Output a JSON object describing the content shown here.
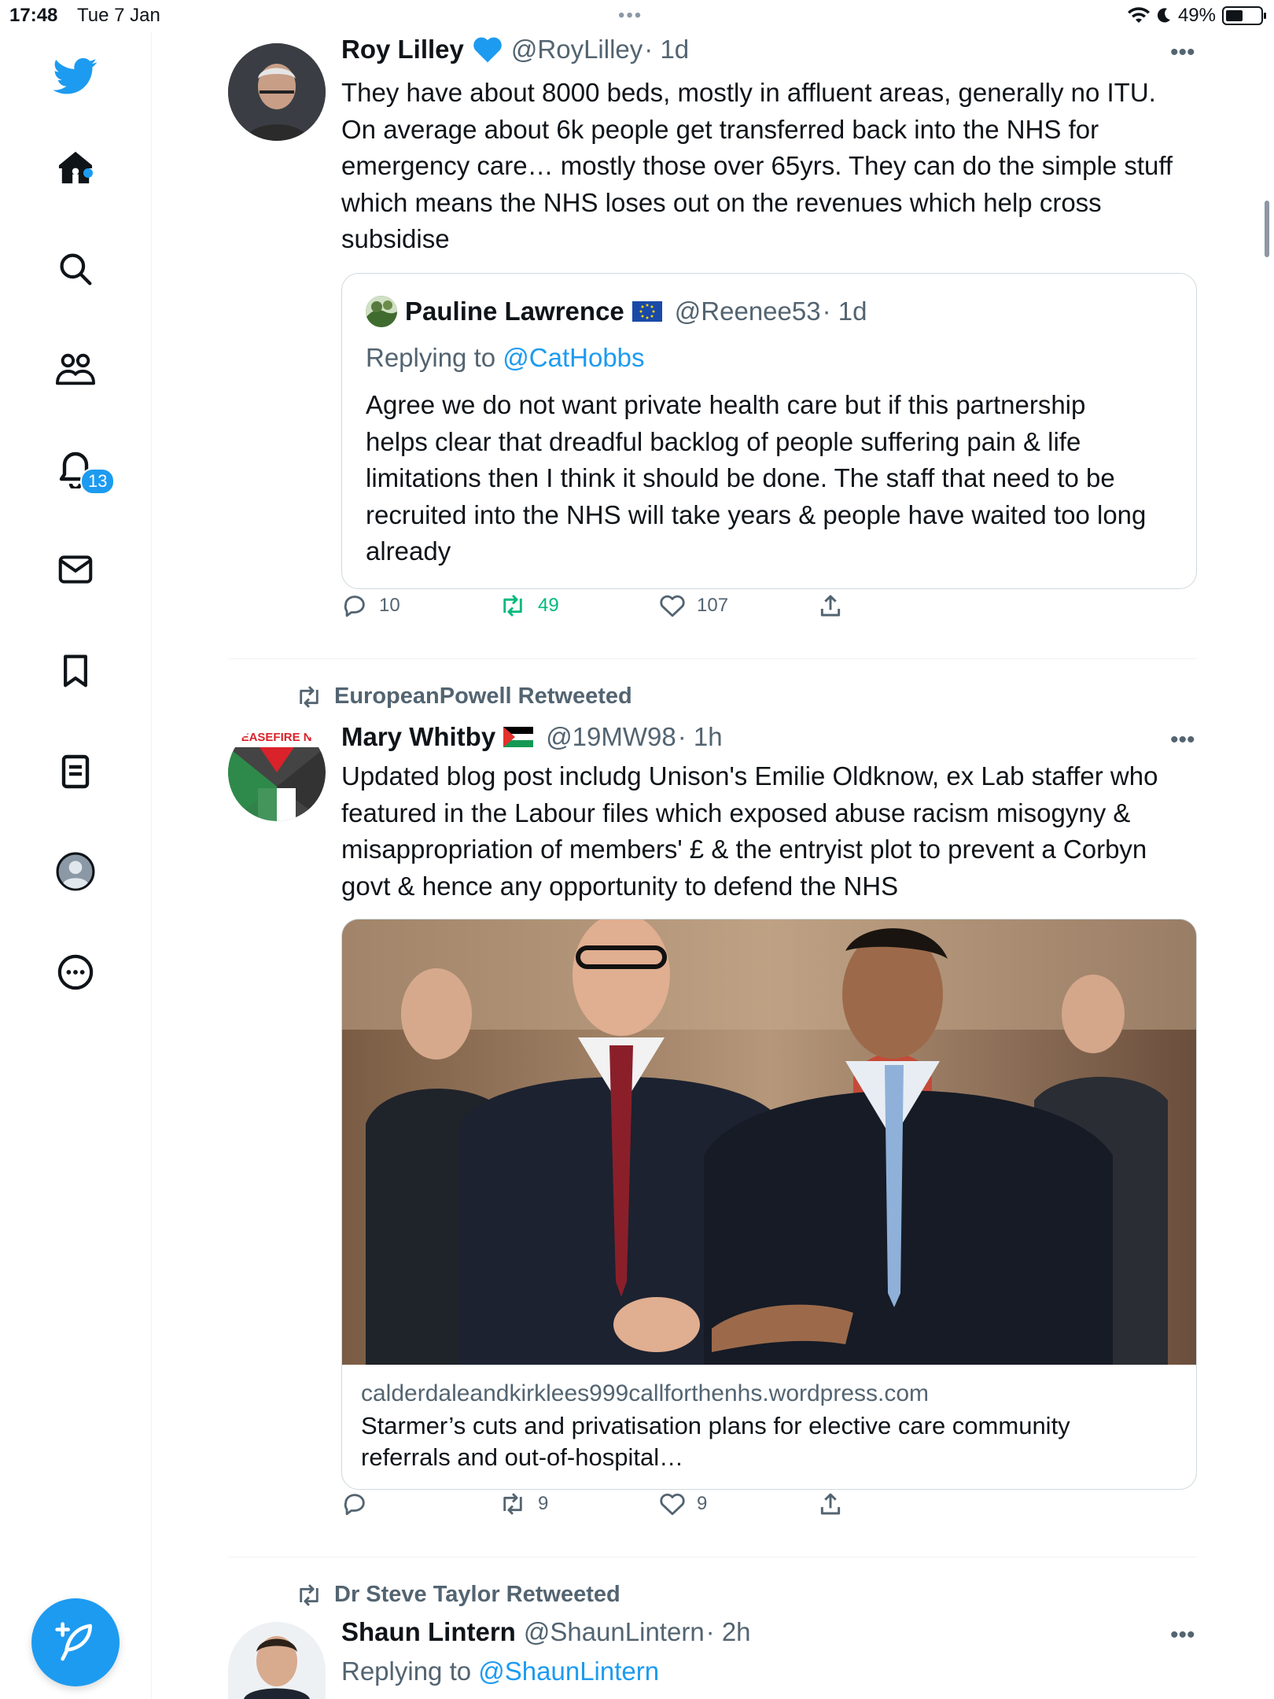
{
  "status_bar": {
    "time": "17:48",
    "date": "Tue 7 Jan",
    "battery": "49%",
    "battery_level": 0.49
  },
  "sidebar": {
    "items": [
      {
        "icon": "twitter-bird-icon"
      },
      {
        "icon": "home-icon"
      },
      {
        "icon": "search-icon"
      },
      {
        "icon": "communities-icon"
      },
      {
        "icon": "notifications-bell-icon",
        "badge": "13"
      },
      {
        "icon": "messages-icon"
      },
      {
        "icon": "bookmark-icon"
      },
      {
        "icon": "lists-icon"
      },
      {
        "icon": "profile-icon"
      },
      {
        "icon": "more-circle-icon"
      }
    ],
    "compose_icon": "compose-feather-icon"
  },
  "tweets": [
    {
      "author": "Roy Lilley",
      "handle": "@RoyLilley",
      "time": "· 1d",
      "verified_icon": "blue-heart-icon",
      "text_lines": [
        "They have about 8000 beds, mostly in affluent areas, generally no ITU.",
        "On average about 6k people get transferred back into the NHS for",
        "emergency care… mostly those over 65yrs. They can do the simple stuff",
        "which means the NHS loses out on the revenues which help cross",
        "subsidise"
      ],
      "quote": {
        "author": "Pauline Lawrence",
        "handle": "@Reenee53",
        "time": "· 1d",
        "replying_prefix": "Replying to",
        "replying_to": "@CatHobbs",
        "text_lines": [
          "Agree we do not want private health care but if this partnership",
          "helps clear that dreadful backlog of people suffering pain & life",
          "limitations then I think it should be done. The staff that need to be",
          "recruited into the NHS will take years & people have waited too long",
          "already"
        ]
      },
      "replies": "10",
      "retweets": "49",
      "likes": "107"
    },
    {
      "retweeted_by": "EuropeanPowell Retweeted",
      "author": "Mary Whitby",
      "handle": "@19MW98",
      "time": "· 1h",
      "avatar_text": "CEASEFIRE NO",
      "text_lines": [
        "Updated blog post includg Unison's Emilie Oldknow, ex Lab staffer who",
        "featured in the Labour files which exposed abuse racism misogyny &",
        "misappropriation of members' £ & the entryist plot to prevent a Corbyn",
        "govt & hence any opportunity to defend the NHS"
      ],
      "card": {
        "domain": "calderdaleandkirklees999callforthenhs.wordpress.com",
        "title_lines": [
          "Starmer’s cuts and privatisation plans for elective care community",
          "referrals and out-of-hospital…"
        ]
      },
      "replies": "",
      "retweets": "9",
      "likes": "9"
    },
    {
      "retweeted_by": "Dr Steve Taylor Retweeted",
      "author": "Shaun Lintern",
      "handle": "@ShaunLintern",
      "time": "· 2h",
      "replying_prefix": "Replying to",
      "replying_to": "@ShaunLintern"
    }
  ]
}
